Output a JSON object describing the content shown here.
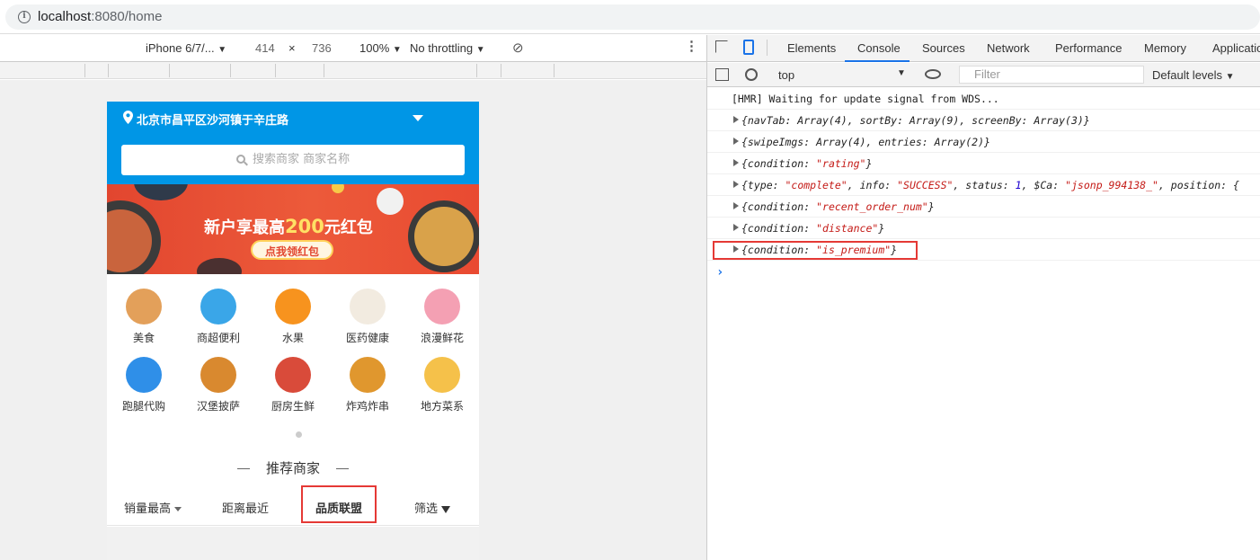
{
  "browser": {
    "url_host": "localhost",
    "url_path": ":8080/home"
  },
  "device_toolbar": {
    "device": "iPhone 6/7/...",
    "width": "414",
    "times": "×",
    "height": "736",
    "zoom": "100%",
    "throttle": "No throttling"
  },
  "app": {
    "location": "北京市昌平区沙河镇于辛庄路",
    "search_placeholder": "搜索商家 商家名称",
    "banner": {
      "title_prefix": "新户享最高",
      "title_amount": "200",
      "title_suffix": "元红包",
      "button": "点我领红包"
    },
    "categories": [
      {
        "label": "美食",
        "color": "#e3a05a"
      },
      {
        "label": "商超便利",
        "color": "#3aa6e8"
      },
      {
        "label": "水果",
        "color": "#f7931e"
      },
      {
        "label": "医药健康",
        "color": "#f2ebe0"
      },
      {
        "label": "浪漫鲜花",
        "color": "#f4a0b3"
      },
      {
        "label": "跑腿代购",
        "color": "#2f8fe8"
      },
      {
        "label": "汉堡披萨",
        "color": "#d9892f"
      },
      {
        "label": "厨房生鲜",
        "color": "#d94b3a"
      },
      {
        "label": "炸鸡炸串",
        "color": "#e0972e"
      },
      {
        "label": "地方菜系",
        "color": "#f5c14a"
      }
    ],
    "recommend_title": "推荐商家",
    "sort": {
      "sales": "销量最高",
      "distance": "距离最近",
      "quality": "品质联盟",
      "filter": "筛选"
    }
  },
  "devtools": {
    "tabs": [
      "Elements",
      "Console",
      "Sources",
      "Network",
      "Performance",
      "Memory",
      "Applicatio"
    ],
    "active_tab": "Console",
    "context": "top",
    "filter_placeholder": "Filter",
    "levels": "Default levels"
  },
  "console": {
    "hmr": "[HMR] Waiting for update signal from WDS...",
    "rows": [
      "{navTab: Array(4), sortBy: Array(9), screenBy: Array(3)}",
      "{swipeImgs: Array(4), entries: Array(2)}"
    ],
    "row_rating_key": "{condition: ",
    "row_rating_val": "\"rating\"",
    "row_type_prefix": "{type: ",
    "row_type_complete": "\"complete\"",
    "row_type_mid1": ", info: ",
    "row_type_success": "\"SUCCESS\"",
    "row_type_mid2": ", status: ",
    "row_type_status": "1",
    "row_type_mid3": ", $Ca: ",
    "row_type_jsonp": "\"jsonp_994138_\"",
    "row_type_tail": ", position: {",
    "row_recent_val": "\"recent_order_num\"",
    "row_distance_val": "\"distance\"",
    "row_premium_val": "\"is_premium\"",
    "close": "}"
  }
}
